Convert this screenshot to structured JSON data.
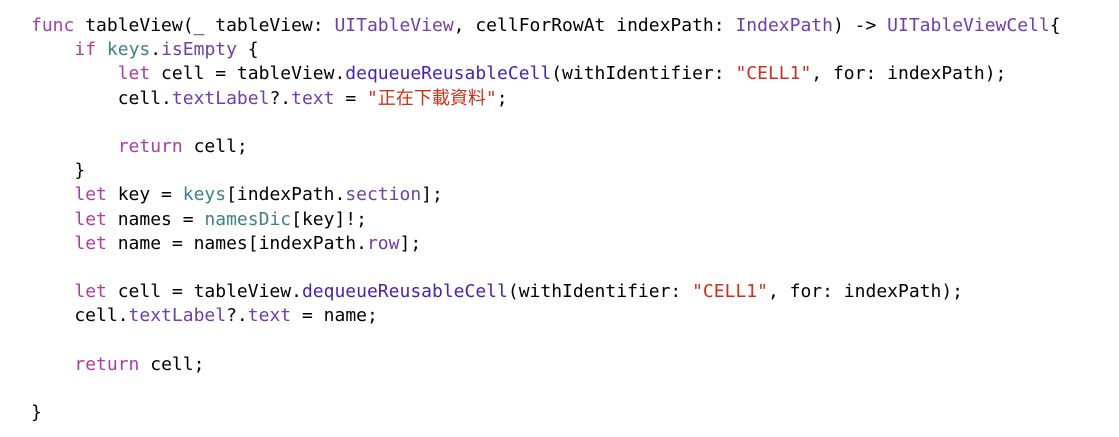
{
  "colors": {
    "background": "#ffffff",
    "plain": "#000000",
    "keyword": "#ad3da4",
    "type": "#703daa",
    "property": "#3e8087",
    "method": "#4b21b0",
    "string": "#d12f1b"
  },
  "lines": [
    [
      {
        "t": "func",
        "c": "kw"
      },
      {
        "t": " tableView(_ tableView: ",
        "c": "pl"
      },
      {
        "t": "UITableView",
        "c": "ty"
      },
      {
        "t": ", cellForRowAt indexPath: ",
        "c": "pl"
      },
      {
        "t": "IndexPath",
        "c": "ty"
      },
      {
        "t": ") -> ",
        "c": "pl"
      },
      {
        "t": "UITableViewCell",
        "c": "ty"
      },
      {
        "t": "{",
        "c": "pl"
      }
    ],
    [
      {
        "t": "    ",
        "c": "pl"
      },
      {
        "t": "if",
        "c": "kw"
      },
      {
        "t": " ",
        "c": "pl"
      },
      {
        "t": "keys",
        "c": "pr"
      },
      {
        "t": ".",
        "c": "pl"
      },
      {
        "t": "isEmpty",
        "c": "ty"
      },
      {
        "t": " {",
        "c": "pl"
      }
    ],
    [
      {
        "t": "        ",
        "c": "pl"
      },
      {
        "t": "let",
        "c": "kw"
      },
      {
        "t": " cell = tableView.",
        "c": "pl"
      },
      {
        "t": "dequeueReusableCell",
        "c": "fn"
      },
      {
        "t": "(withIdentifier: ",
        "c": "pl"
      },
      {
        "t": "\"CELL1\"",
        "c": "st"
      },
      {
        "t": ", for: indexPath);",
        "c": "pl"
      }
    ],
    [
      {
        "t": "        cell.",
        "c": "pl"
      },
      {
        "t": "textLabel",
        "c": "ty"
      },
      {
        "t": "?.",
        "c": "pl"
      },
      {
        "t": "text",
        "c": "ty"
      },
      {
        "t": " = ",
        "c": "pl"
      },
      {
        "t": "\"",
        "c": "st"
      },
      {
        "t": "正在下載資料",
        "c": "st cjk"
      },
      {
        "t": "\"",
        "c": "st"
      },
      {
        "t": ";",
        "c": "pl"
      }
    ],
    [],
    [
      {
        "t": "        ",
        "c": "pl"
      },
      {
        "t": "return",
        "c": "kw"
      },
      {
        "t": " cell;",
        "c": "pl"
      }
    ],
    [
      {
        "t": "    }",
        "c": "pl"
      }
    ],
    [
      {
        "t": "    ",
        "c": "pl"
      },
      {
        "t": "let",
        "c": "kw"
      },
      {
        "t": " key = ",
        "c": "pl"
      },
      {
        "t": "keys",
        "c": "pr"
      },
      {
        "t": "[indexPath.",
        "c": "pl"
      },
      {
        "t": "section",
        "c": "ty"
      },
      {
        "t": "];",
        "c": "pl"
      }
    ],
    [
      {
        "t": "    ",
        "c": "pl"
      },
      {
        "t": "let",
        "c": "kw"
      },
      {
        "t": " names = ",
        "c": "pl"
      },
      {
        "t": "namesDic",
        "c": "pr"
      },
      {
        "t": "[key]!;",
        "c": "pl"
      }
    ],
    [
      {
        "t": "    ",
        "c": "pl"
      },
      {
        "t": "let",
        "c": "kw"
      },
      {
        "t": " name = names[indexPath.",
        "c": "pl"
      },
      {
        "t": "row",
        "c": "ty"
      },
      {
        "t": "];",
        "c": "pl"
      }
    ],
    [],
    [
      {
        "t": "    ",
        "c": "pl"
      },
      {
        "t": "let",
        "c": "kw"
      },
      {
        "t": " cell = tableView.",
        "c": "pl"
      },
      {
        "t": "dequeueReusableCell",
        "c": "fn"
      },
      {
        "t": "(withIdentifier: ",
        "c": "pl"
      },
      {
        "t": "\"CELL1\"",
        "c": "st"
      },
      {
        "t": ", for: indexPath);",
        "c": "pl"
      }
    ],
    [
      {
        "t": "    cell.",
        "c": "pl"
      },
      {
        "t": "textLabel",
        "c": "ty"
      },
      {
        "t": "?.",
        "c": "pl"
      },
      {
        "t": "text",
        "c": "ty"
      },
      {
        "t": " = name;",
        "c": "pl"
      }
    ],
    [],
    [
      {
        "t": "    ",
        "c": "pl"
      },
      {
        "t": "return",
        "c": "kw"
      },
      {
        "t": " cell;",
        "c": "pl"
      }
    ],
    [],
    [
      {
        "t": "}",
        "c": "pl"
      }
    ]
  ]
}
